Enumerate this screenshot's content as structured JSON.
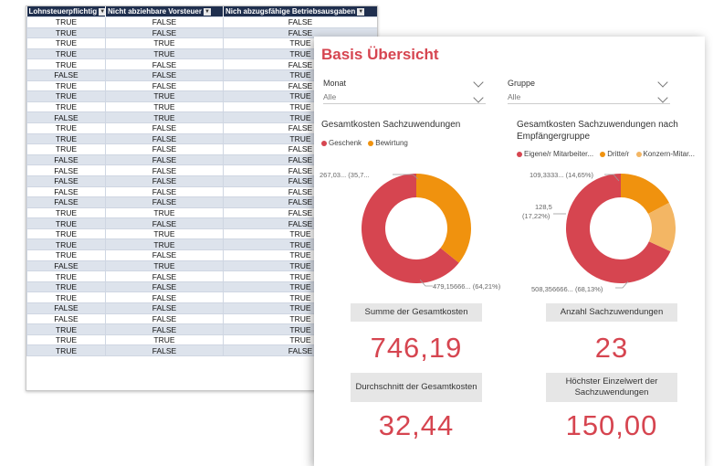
{
  "sheet": {
    "headers": [
      "Lohnsteuerpflichtig",
      "Nicht abziehbare Vorsteuer",
      "Nich abzugsfähige Betriebsausgaben"
    ],
    "rows": [
      [
        "TRUE",
        "FALSE",
        "FALSE"
      ],
      [
        "TRUE",
        "FALSE",
        "FALSE"
      ],
      [
        "TRUE",
        "TRUE",
        "TRUE"
      ],
      [
        "TRUE",
        "TRUE",
        "TRUE"
      ],
      [
        "TRUE",
        "FALSE",
        "FALSE"
      ],
      [
        "FALSE",
        "FALSE",
        "TRUE"
      ],
      [
        "TRUE",
        "FALSE",
        "FALSE"
      ],
      [
        "TRUE",
        "TRUE",
        "TRUE"
      ],
      [
        "TRUE",
        "TRUE",
        "TRUE"
      ],
      [
        "FALSE",
        "TRUE",
        "TRUE"
      ],
      [
        "TRUE",
        "FALSE",
        "FALSE"
      ],
      [
        "TRUE",
        "FALSE",
        "TRUE"
      ],
      [
        "TRUE",
        "FALSE",
        "FALSE"
      ],
      [
        "FALSE",
        "FALSE",
        "FALSE"
      ],
      [
        "FALSE",
        "FALSE",
        "FALSE"
      ],
      [
        "FALSE",
        "FALSE",
        "FALSE"
      ],
      [
        "FALSE",
        "FALSE",
        "FALSE"
      ],
      [
        "FALSE",
        "FALSE",
        "FALSE"
      ],
      [
        "TRUE",
        "TRUE",
        "FALSE"
      ],
      [
        "TRUE",
        "FALSE",
        "FALSE"
      ],
      [
        "TRUE",
        "TRUE",
        "TRUE"
      ],
      [
        "TRUE",
        "TRUE",
        "TRUE"
      ],
      [
        "TRUE",
        "FALSE",
        "TRUE"
      ],
      [
        "FALSE",
        "TRUE",
        "TRUE"
      ],
      [
        "TRUE",
        "FALSE",
        "TRUE"
      ],
      [
        "TRUE",
        "FALSE",
        "TRUE"
      ],
      [
        "TRUE",
        "FALSE",
        "TRUE"
      ],
      [
        "FALSE",
        "FALSE",
        "TRUE"
      ],
      [
        "FALSE",
        "FALSE",
        "TRUE"
      ],
      [
        "TRUE",
        "FALSE",
        "TRUE"
      ],
      [
        "TRUE",
        "TRUE",
        "TRUE"
      ],
      [
        "TRUE",
        "FALSE",
        "FALSE"
      ]
    ]
  },
  "report": {
    "title": "Basis Übersicht",
    "slicer_month": {
      "label": "Monat",
      "value": "Alle"
    },
    "slicer_group": {
      "label": "Gruppe",
      "value": "Alle"
    },
    "chart1": {
      "title": "Gesamtkosten Sachzuwendungen",
      "legend": [
        {
          "name": "Geschenk",
          "color": "#d64550"
        },
        {
          "name": "Bewirtung",
          "color": "#f0920e"
        }
      ],
      "label_small": "267,03... (35,7...",
      "label_large": "479,15666... (64,21%)"
    },
    "chart2": {
      "title": "Gesamtkosten Sachzuwendungen nach Empfängergruppe",
      "legend": [
        {
          "name": "Eigene/r Mitarbeiter...",
          "color": "#d64550"
        },
        {
          "name": "Dritte/r",
          "color": "#f0920e"
        },
        {
          "name": "Konzern-Mitar...",
          "color": "#f3b664"
        }
      ],
      "label_top": "109,3333... (14,65%)",
      "label_mid_1": "128,5",
      "label_mid_2": "(17,22%)",
      "label_large": "508,356666... (68,13%)"
    },
    "kpis": {
      "sum_label": "Summe der Gesamtkosten",
      "sum_value": "746,19",
      "count_label": "Anzahl Sachzuwendungen",
      "count_value": "23",
      "avg_label": "Durchschnitt der Gesamtkosten",
      "avg_value": "32,44",
      "max_label": "Höchster Einzelwert der Sachzuwendungen",
      "max_value": "150,00"
    }
  },
  "chart_data": [
    {
      "type": "pie",
      "title": "Gesamtkosten Sachzuwendungen",
      "categories": [
        "Geschenk",
        "Bewirtung"
      ],
      "values": [
        479.15666,
        267.03
      ],
      "percent": [
        64.21,
        35.79
      ],
      "colors": [
        "#d64550",
        "#f0920e"
      ]
    },
    {
      "type": "pie",
      "title": "Gesamtkosten Sachzuwendungen nach Empfängergruppe",
      "categories": [
        "Eigene/r Mitarbeiter...",
        "Dritte/r",
        "Konzern-Mitar..."
      ],
      "values": [
        508.356666,
        128.5,
        109.3333
      ],
      "percent": [
        68.13,
        17.22,
        14.65
      ],
      "colors": [
        "#d64550",
        "#f0920e",
        "#f3b664"
      ]
    }
  ]
}
